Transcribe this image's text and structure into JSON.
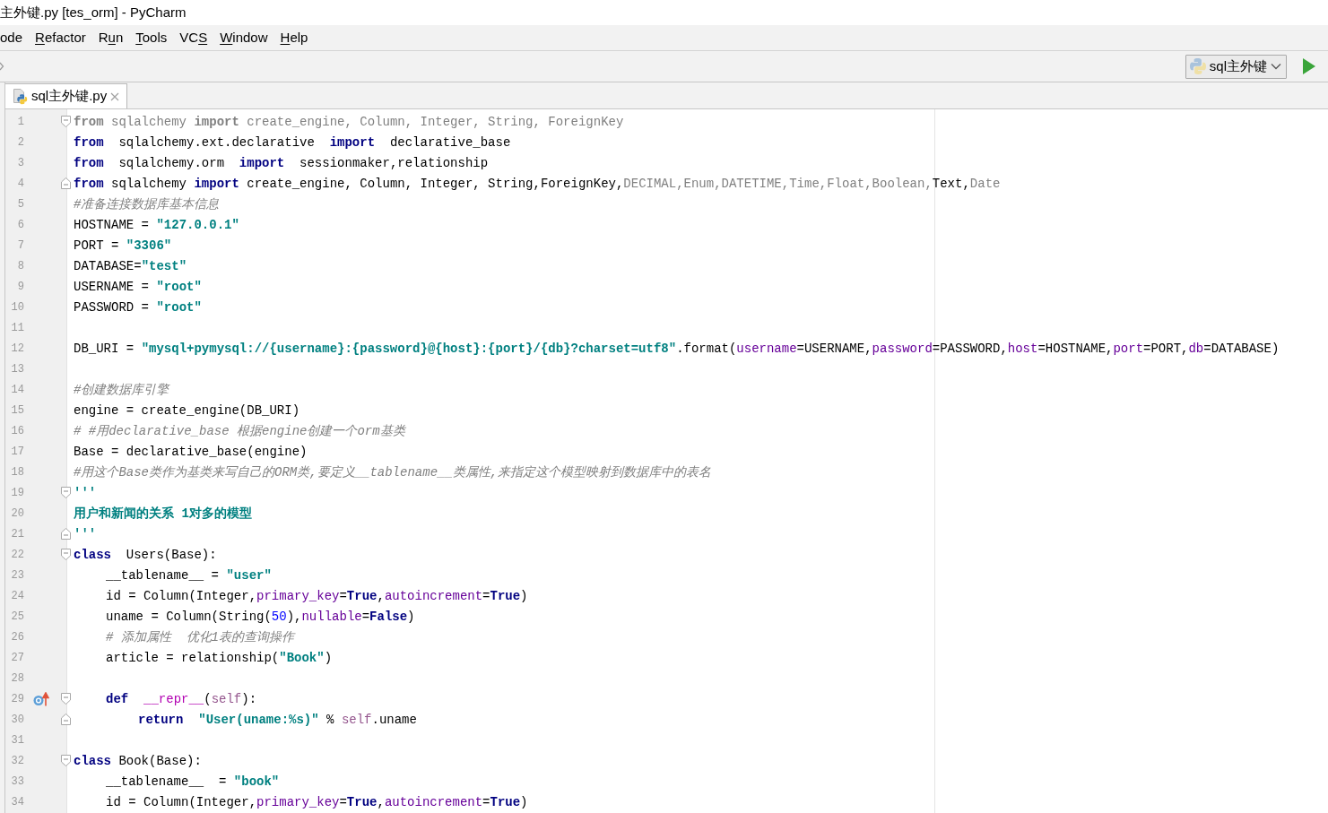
{
  "window": {
    "title": "主外键.py [tes_orm] - PyCharm"
  },
  "menu": [
    {
      "label_parts": [
        {
          "text": "ode",
          "underlined": false
        }
      ]
    },
    {
      "label_parts": [
        {
          "text": "R",
          "underlined": true
        },
        {
          "text": "efactor",
          "underlined": false
        }
      ]
    },
    {
      "label_parts": [
        {
          "text": "R",
          "underlined": false
        },
        {
          "text": "u",
          "underlined": true
        },
        {
          "text": "n",
          "underlined": false
        }
      ]
    },
    {
      "label_parts": [
        {
          "text": "T",
          "underlined": true
        },
        {
          "text": "ools",
          "underlined": false
        }
      ]
    },
    {
      "label_parts": [
        {
          "text": "VC",
          "underlined": false
        },
        {
          "text": "S",
          "underlined": true
        }
      ]
    },
    {
      "label_parts": [
        {
          "text": "W",
          "underlined": true
        },
        {
          "text": "indow",
          "underlined": false
        }
      ]
    },
    {
      "label_parts": [
        {
          "text": "H",
          "underlined": true
        },
        {
          "text": "elp",
          "underlined": false
        }
      ]
    }
  ],
  "run_config": {
    "label": "sql主外键"
  },
  "tabs": [
    {
      "label": "sql主外键.py",
      "selected": true
    }
  ],
  "editor": {
    "lines": [
      {
        "number": "1",
        "fold": {
          "kind": "start"
        },
        "tokens": [
          {
            "kind": "unused_keyword",
            "text": "from"
          },
          {
            "kind": "unused",
            "text": " sqlalchemy "
          },
          {
            "kind": "unused_keyword",
            "text": "import"
          },
          {
            "kind": "unused",
            "text": " create_engine, Column, Integer, String, ForeignKey"
          }
        ]
      },
      {
        "number": "2",
        "tokens": [
          {
            "kind": "keyword",
            "text": "from"
          },
          {
            "kind": "plain",
            "text": "  sqlalchemy.ext.declarative  "
          },
          {
            "kind": "keyword",
            "text": "import"
          },
          {
            "kind": "plain",
            "text": "  declarative_base"
          }
        ]
      },
      {
        "number": "3",
        "tokens": [
          {
            "kind": "keyword",
            "text": "from"
          },
          {
            "kind": "plain",
            "text": "  sqlalchemy.orm  "
          },
          {
            "kind": "keyword",
            "text": "import"
          },
          {
            "kind": "plain",
            "text": "  sessionmaker,relationship"
          }
        ]
      },
      {
        "number": "4",
        "fold": {
          "kind": "end"
        },
        "tokens": [
          {
            "kind": "keyword",
            "text": "from"
          },
          {
            "kind": "plain",
            "text": " sqlalchemy "
          },
          {
            "kind": "keyword",
            "text": "import"
          },
          {
            "kind": "plain",
            "text": " create_engine, Column, Integer, String,ForeignKey,"
          },
          {
            "kind": "unused",
            "text": "DECIMAL,Enum,DATETIME,Time,Float,Boolean,"
          },
          {
            "kind": "plain",
            "text": "Text,"
          },
          {
            "kind": "unused",
            "text": "Date"
          }
        ]
      },
      {
        "number": "5",
        "tokens": [
          {
            "kind": "comment",
            "text": "#准备连接数据库基本信息"
          }
        ]
      },
      {
        "number": "6",
        "tokens": [
          {
            "kind": "plain",
            "text": "HOSTNAME = "
          },
          {
            "kind": "string",
            "text": "\"127.0.0.1\""
          }
        ]
      },
      {
        "number": "7",
        "tokens": [
          {
            "kind": "plain",
            "text": "PORT = "
          },
          {
            "kind": "string",
            "text": "\"3306\""
          }
        ]
      },
      {
        "number": "8",
        "tokens": [
          {
            "kind": "plain",
            "text": "DATABASE="
          },
          {
            "kind": "string",
            "text": "\"test\""
          }
        ]
      },
      {
        "number": "9",
        "tokens": [
          {
            "kind": "plain",
            "text": "USERNAME = "
          },
          {
            "kind": "string",
            "text": "\"root\""
          }
        ]
      },
      {
        "number": "10",
        "tokens": [
          {
            "kind": "plain",
            "text": "PASSWORD = "
          },
          {
            "kind": "string",
            "text": "\"root\""
          }
        ]
      },
      {
        "number": "11"
      },
      {
        "number": "12",
        "tokens": [
          {
            "kind": "plain",
            "text": "DB_URI = "
          },
          {
            "kind": "string",
            "text": "\"mysql+pymysql://{username}:{password}@{host}:{port}/{db}?charset=utf8\""
          },
          {
            "kind": "plain",
            "text": ".format("
          },
          {
            "kind": "param",
            "text": "username"
          },
          {
            "kind": "plain",
            "text": "=USERNAME,"
          },
          {
            "kind": "param",
            "text": "password"
          },
          {
            "kind": "plain",
            "text": "=PASSWORD,"
          },
          {
            "kind": "param",
            "text": "host"
          },
          {
            "kind": "plain",
            "text": "=HOSTNAME,"
          },
          {
            "kind": "param",
            "text": "port"
          },
          {
            "kind": "plain",
            "text": "=PORT,"
          },
          {
            "kind": "param",
            "text": "db"
          },
          {
            "kind": "plain",
            "text": "=DATABASE)"
          }
        ]
      },
      {
        "number": "13"
      },
      {
        "number": "14",
        "tokens": [
          {
            "kind": "comment",
            "text": "#创建数据库引擎"
          }
        ]
      },
      {
        "number": "15",
        "tokens": [
          {
            "kind": "plain",
            "text": "engine = create_engine(DB_URI)"
          }
        ]
      },
      {
        "number": "16",
        "tokens": [
          {
            "kind": "comment",
            "text": "# #用declarative_base 根据engine创建一个orm基类"
          }
        ]
      },
      {
        "number": "17",
        "tokens": [
          {
            "kind": "plain",
            "text": "Base = declarative_base(engine)"
          }
        ]
      },
      {
        "number": "18",
        "tokens": [
          {
            "kind": "comment",
            "text": "#用这个Base类作为基类来写自己的ORM类,要定义__tablename__类属性,来指定这个模型映射到数据库中的表名"
          }
        ]
      },
      {
        "number": "19",
        "fold": {
          "kind": "start"
        },
        "tokens": [
          {
            "kind": "string",
            "text": "'''"
          }
        ]
      },
      {
        "number": "20",
        "tokens": [
          {
            "kind": "string",
            "text": "用户和新闻的关系 1对多的模型"
          }
        ]
      },
      {
        "number": "21",
        "fold": {
          "kind": "end"
        },
        "tokens": [
          {
            "kind": "string",
            "text": "'''"
          }
        ]
      },
      {
        "number": "22",
        "fold": {
          "kind": "start"
        },
        "tokens": [
          {
            "kind": "keyword",
            "text": "class"
          },
          {
            "kind": "plain",
            "text": "  Users(Base):"
          }
        ],
        "children": [
          {
            "number": "23",
            "tokens": [
              {
                "kind": "plain",
                "text": "__tablename__ = "
              },
              {
                "kind": "string",
                "text": "\"user\""
              }
            ]
          },
          {
            "number": "24",
            "tokens": [
              {
                "kind": "plain",
                "text": "id = Column(Integer,"
              },
              {
                "kind": "param",
                "text": "primary_key"
              },
              {
                "kind": "plain",
                "text": "="
              },
              {
                "kind": "keyword",
                "text": "True"
              },
              {
                "kind": "plain",
                "text": ","
              },
              {
                "kind": "param",
                "text": "autoincrement"
              },
              {
                "kind": "plain",
                "text": "="
              },
              {
                "kind": "keyword",
                "text": "True"
              },
              {
                "kind": "plain",
                "text": ")"
              }
            ]
          },
          {
            "number": "25",
            "tokens": [
              {
                "kind": "plain",
                "text": "uname = Column(String("
              },
              {
                "kind": "number",
                "text": "50"
              },
              {
                "kind": "plain",
                "text": "),"
              },
              {
                "kind": "param",
                "text": "nullable"
              },
              {
                "kind": "plain",
                "text": "="
              },
              {
                "kind": "keyword",
                "text": "False"
              },
              {
                "kind": "plain",
                "text": ")"
              }
            ]
          },
          {
            "number": "26",
            "tokens": [
              {
                "kind": "comment",
                "text": "# 添加属性  优化1表的查询操作"
              }
            ]
          },
          {
            "number": "27",
            "tokens": [
              {
                "kind": "plain",
                "text": "article = relationship("
              },
              {
                "kind": "string",
                "text": "\"Book\""
              },
              {
                "kind": "plain",
                "text": ")"
              }
            ]
          },
          {
            "number": "28"
          },
          {
            "number": "29",
            "fold": {
              "kind": "start"
            },
            "gutter_mark": {
              "kind": "override"
            },
            "tokens": [
              {
                "kind": "keyword",
                "text": "def"
              },
              {
                "kind": "magic",
                "text": "  __repr__"
              },
              {
                "kind": "plain",
                "text": "("
              },
              {
                "kind": "self",
                "text": "self"
              },
              {
                "kind": "plain",
                "text": "):"
              }
            ],
            "children": [
              {
                "number": "30",
                "fold": {
                  "kind": "end"
                },
                "tokens": [
                  {
                    "kind": "keyword",
                    "text": "return"
                  },
                  {
                    "kind": "string",
                    "text": "  \"User(uname:%s)\""
                  },
                  {
                    "kind": "plain",
                    "text": " % "
                  },
                  {
                    "kind": "self",
                    "text": "self"
                  },
                  {
                    "kind": "plain",
                    "text": ".uname"
                  }
                ]
              }
            ]
          }
        ]
      },
      {
        "number": "31"
      },
      {
        "number": "32",
        "fold": {
          "kind": "start"
        },
        "tokens": [
          {
            "kind": "keyword",
            "text": "class"
          },
          {
            "kind": "plain",
            "text": " Book(Base):"
          }
        ],
        "children": [
          {
            "number": "33",
            "tokens": [
              {
                "kind": "plain",
                "text": "__tablename__  = "
              },
              {
                "kind": "string",
                "text": "\"book\""
              }
            ]
          },
          {
            "number": "34",
            "tokens": [
              {
                "kind": "plain",
                "text": "id = Column(Integer,"
              },
              {
                "kind": "param",
                "text": "primary_key"
              },
              {
                "kind": "plain",
                "text": "="
              },
              {
                "kind": "keyword",
                "text": "True"
              },
              {
                "kind": "plain",
                "text": ","
              },
              {
                "kind": "param",
                "text": "autoincrement"
              },
              {
                "kind": "plain",
                "text": "="
              },
              {
                "kind": "keyword",
                "text": "True"
              },
              {
                "kind": "plain",
                "text": ")"
              }
            ]
          }
        ]
      }
    ]
  }
}
